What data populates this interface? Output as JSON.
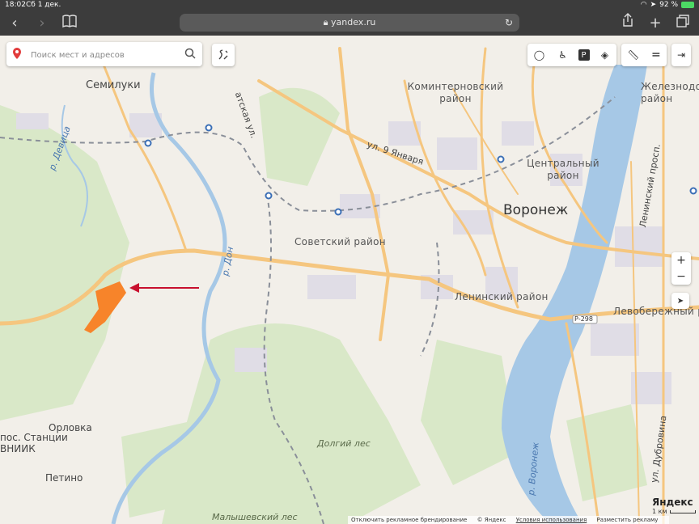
{
  "status_bar": {
    "time": "18:02",
    "date": "Сб 1 дек.",
    "battery_percent": "92 %"
  },
  "browser": {
    "url": "yandex.ru"
  },
  "search": {
    "placeholder": "Поиск мест и адресов"
  },
  "map_labels": {
    "semiluki": "Семилуки",
    "kominternovsky": "Коминтерновский район",
    "zheleznodorozhny": "Железнодо район",
    "central": "Центральный район",
    "voronezh": "Воронеж",
    "sovetsky": "Советский район",
    "leninsky": "Ленинский район",
    "levoberezhny": "Левобережный р",
    "orlovka": "Орловка",
    "pos_vniik": "пос. Станции ВНИИК",
    "petino": "Петино",
    "dolgiy_les": "Долгий лес",
    "malyshevsky_les": "Малышевский лес",
    "r_devitsa": "р. Девица",
    "r_don": "р. Дон",
    "r_voronezh": "р. Воронеж",
    "ul_9_yanvarya": "ул. 9 Января",
    "leninsky_prosp": "Ленинский просп.",
    "ul_dubrovina": "ул. Дубровина",
    "ul_partial": "атская ул.",
    "road_r298": "Р-298"
  },
  "footer": {
    "disable_branding": "Отключить рекламное брендирование",
    "copyright": "© Яндекс",
    "terms": "Условия использования",
    "place_ad": "Разместить рекламу"
  },
  "logo": "Яндекс",
  "scale_label": "1 км",
  "colors": {
    "highlight_plot": "#f7842a",
    "arrow": "#c8102e",
    "river": "#a6c8e6",
    "road": "#f5c67f"
  }
}
